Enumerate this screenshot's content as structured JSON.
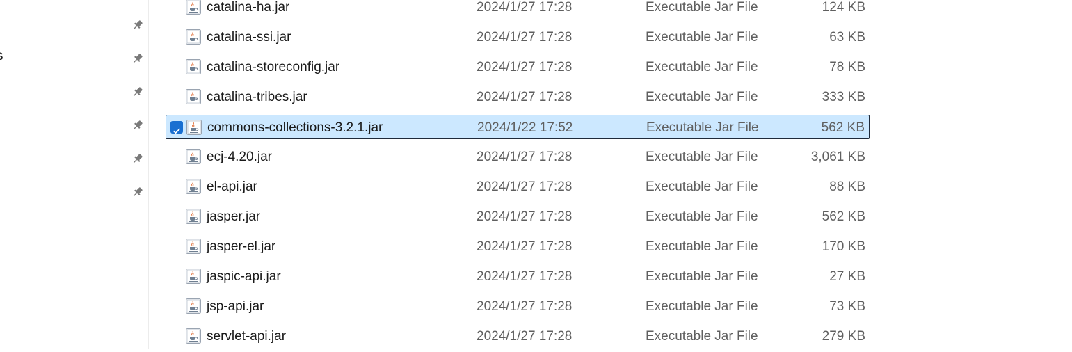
{
  "sidebar": {
    "partial_label": "s",
    "pins": [
      {
        "icon": "pin-icon"
      },
      {
        "icon": "pin-icon"
      },
      {
        "icon": "pin-icon"
      },
      {
        "icon": "pin-icon"
      },
      {
        "icon": "pin-icon"
      },
      {
        "icon": "pin-icon"
      }
    ]
  },
  "files": [
    {
      "name": "catalina-ha.jar",
      "date": "2024/1/27 17:28",
      "type": "Executable Jar File",
      "size": "124 KB",
      "selected": false
    },
    {
      "name": "catalina-ssi.jar",
      "date": "2024/1/27 17:28",
      "type": "Executable Jar File",
      "size": "63 KB",
      "selected": false
    },
    {
      "name": "catalina-storeconfig.jar",
      "date": "2024/1/27 17:28",
      "type": "Executable Jar File",
      "size": "78 KB",
      "selected": false
    },
    {
      "name": "catalina-tribes.jar",
      "date": "2024/1/27 17:28",
      "type": "Executable Jar File",
      "size": "333 KB",
      "selected": false
    },
    {
      "name": "commons-collections-3.2.1.jar",
      "date": "2024/1/22 17:52",
      "type": "Executable Jar File",
      "size": "562 KB",
      "selected": true
    },
    {
      "name": "ecj-4.20.jar",
      "date": "2024/1/27 17:28",
      "type": "Executable Jar File",
      "size": "3,061 KB",
      "selected": false
    },
    {
      "name": "el-api.jar",
      "date": "2024/1/27 17:28",
      "type": "Executable Jar File",
      "size": "88 KB",
      "selected": false
    },
    {
      "name": "jasper.jar",
      "date": "2024/1/27 17:28",
      "type": "Executable Jar File",
      "size": "562 KB",
      "selected": false
    },
    {
      "name": "jasper-el.jar",
      "date": "2024/1/27 17:28",
      "type": "Executable Jar File",
      "size": "170 KB",
      "selected": false
    },
    {
      "name": "jaspic-api.jar",
      "date": "2024/1/27 17:28",
      "type": "Executable Jar File",
      "size": "27 KB",
      "selected": false
    },
    {
      "name": "jsp-api.jar",
      "date": "2024/1/27 17:28",
      "type": "Executable Jar File",
      "size": "73 KB",
      "selected": false
    },
    {
      "name": "servlet-api.jar",
      "date": "2024/1/27 17:28",
      "type": "Executable Jar File",
      "size": "279 KB",
      "selected": false
    }
  ],
  "colors": {
    "selection_bg": "#cce8ff",
    "selection_border": "#1f2a3a",
    "checkbox": "#1a6fd1",
    "secondary_text": "#5f5f5f"
  }
}
